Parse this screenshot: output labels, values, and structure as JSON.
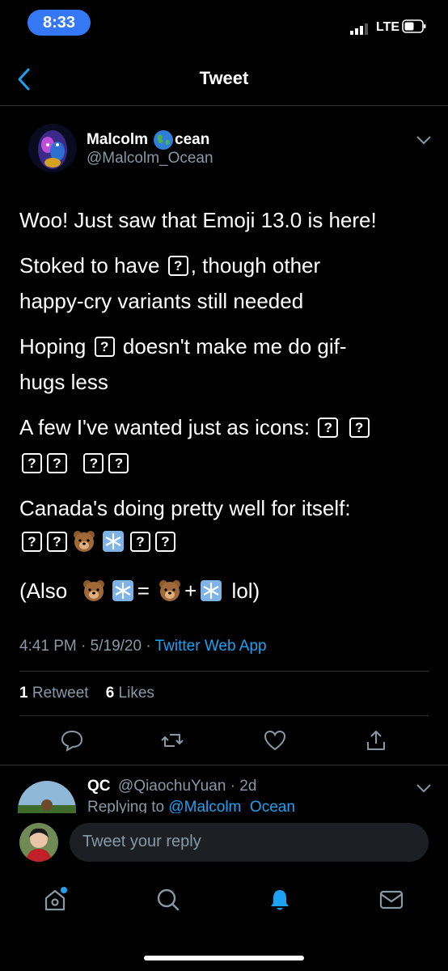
{
  "status_bar": {
    "time": "8:33",
    "network": "LTE"
  },
  "nav": {
    "title": "Tweet"
  },
  "tweet": {
    "author_name_prefix": "Malcolm ",
    "author_name_suffix": "cean",
    "author_handle": "@Malcolm_Ocean",
    "lines": {
      "l1": "Woo! Just saw that Emoji 13.0 is here!",
      "l2a": "Stoked to have",
      "l2b": ", though other",
      "l3": "happy-cry variants still needed",
      "l4a": "Hoping",
      "l4b": "doesn't make me do gif-",
      "l5": "hugs less",
      "l6": "A few I've wanted just as icons:",
      "l8": "Canada's doing pretty well for itself:",
      "l10a": "(Also",
      "l10b": "=",
      "l10c": "+",
      "l10d": "lol)"
    },
    "missing_glyph": "?",
    "time": "4:41 PM",
    "date": "5/19/20",
    "separator": "·",
    "source": "Twitter Web App",
    "retweets_count": "1",
    "retweets_label": "Retweet",
    "likes_count": "6",
    "likes_label": "Likes"
  },
  "reply": {
    "name": "QC",
    "handle_time": "@QiaochuYuan · 2d",
    "context_prefix": "Replying to ",
    "context_handle": "@Malcolm_Ocean"
  },
  "composer": {
    "placeholder": "Tweet your reply"
  },
  "tabs": [
    "home-icon",
    "search-icon",
    "notifications-icon",
    "messages-icon"
  ],
  "colors": {
    "accent": "#1da1f2",
    "status_pill": "#3478f6",
    "muted": "#8899a6",
    "divider": "#2f3336"
  }
}
